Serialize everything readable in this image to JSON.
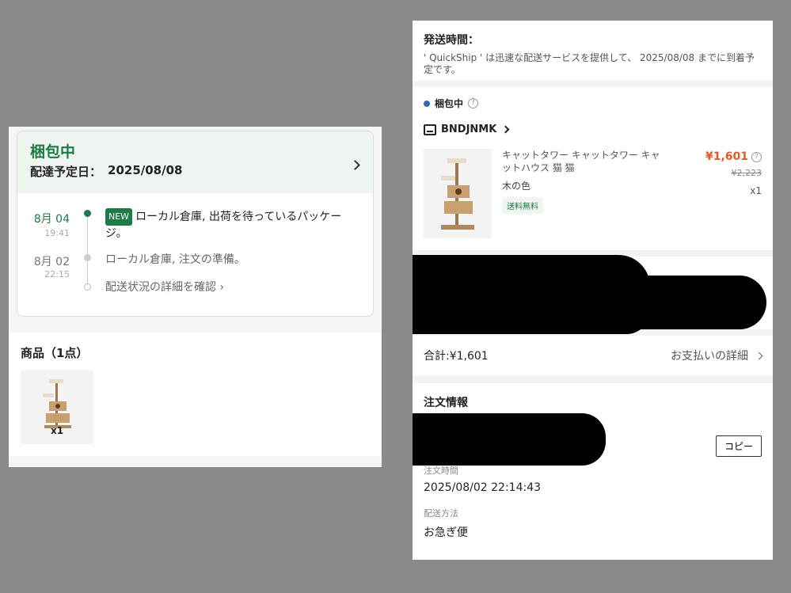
{
  "left": {
    "status": "梱包中",
    "delivery_label": "配達予定日：",
    "delivery_date": "2025/08/08",
    "timeline": [
      {
        "date": "8月 04",
        "time": "19:41",
        "badge": "NEW",
        "text": "ローカル倉庫, 出荷を待っているパッケージ。",
        "active": true
      },
      {
        "date": "8月 02",
        "time": "22:15",
        "text": "ローカル倉庫, 注文の準備。",
        "active": false
      }
    ],
    "details_link": "配送状況の詳細を確認 ›",
    "products_title": "商品（1点）",
    "product_qty": "x1"
  },
  "right": {
    "shipping_title": "発送時間：",
    "shipping_desc": "' QuickShip ' は迅速な配送サービスを提供して、 2025/08/08 までに到着予定です。",
    "package_status": "梱包中",
    "store_name": "BNDJNMK",
    "product_name": "キャットタワー キャットタワー キャットハウス 猫 猫",
    "product_color": "木の色",
    "free_shipping": "送料無料",
    "price": "¥1,601",
    "original_price": "¥2,223",
    "quantity": "x1",
    "total": "合計:¥1,601",
    "payment_details": "お支払いの詳細",
    "order_info_title": "注文情報",
    "copy_label": "コピー",
    "order_time_label": "注文時間",
    "order_time": "2025/08/02 22:14:43",
    "shipping_method_label": "配送方法",
    "shipping_method": "お急ぎ便"
  },
  "colors": {
    "accent_green": "#1e7a47",
    "price_orange": "#e45a2a",
    "status_blue": "#2f6cb3"
  }
}
